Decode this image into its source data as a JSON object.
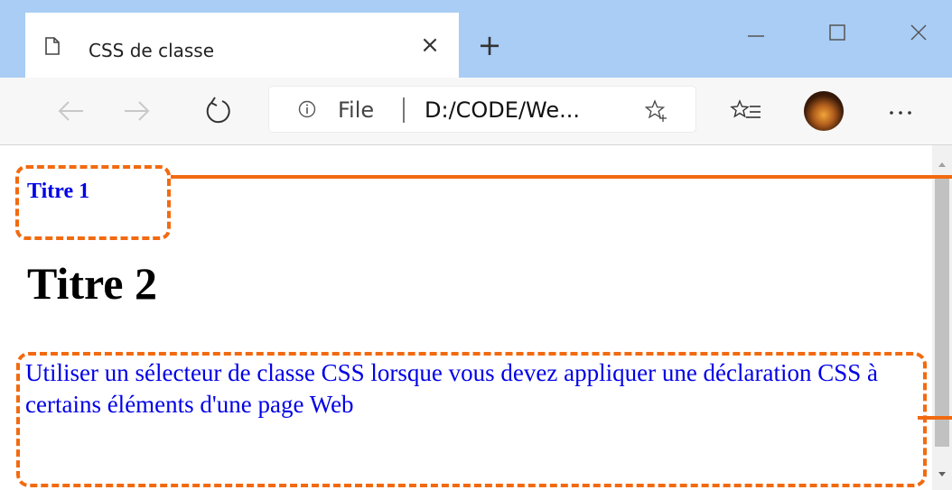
{
  "browser": {
    "tab_title": "CSS de classe",
    "tab_close_glyph": "×",
    "new_tab_glyph": "+",
    "address": {
      "file_label": "File",
      "url": "D:/CODE/We..."
    }
  },
  "page": {
    "title1": "Titre 1",
    "title2": "Titre 2",
    "paragraph": "Utiliser un sélecteur de classe CSS lorsque vous devez appliquer une déclaration CSS à certains éléments d'une page Web"
  },
  "colors": {
    "tabbar_bg": "#a9cdf5",
    "toolbar_bg": "#f7f7f7",
    "link_blue": "#0000e6",
    "annotation_orange": "#f26a10"
  },
  "icons": {
    "tab": "document-icon",
    "close": "close-icon",
    "new_tab": "plus-icon",
    "back": "back-arrow-icon",
    "forward": "forward-arrow-icon",
    "refresh": "refresh-icon",
    "info": "info-icon",
    "favorite": "star-plus-icon",
    "favorites": "favorites-list-icon",
    "more": "ellipsis-icon"
  }
}
